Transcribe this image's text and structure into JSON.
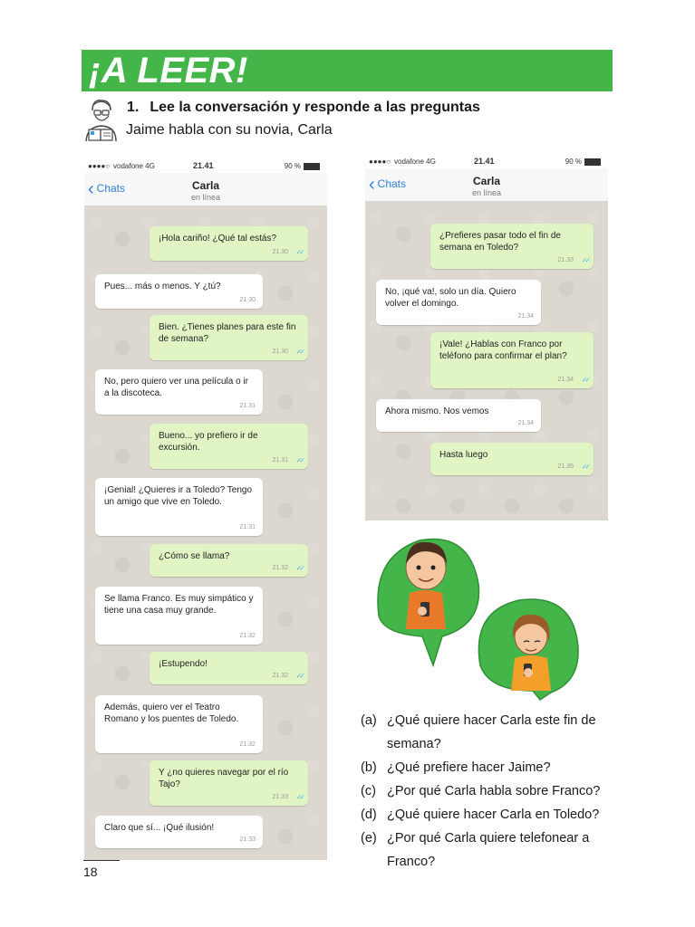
{
  "header": {
    "title": "¡A LEER!"
  },
  "exercise": {
    "number": "1.",
    "instruction": "Lee la conversación y responde a las preguntas",
    "subtitle": "Jaime habla con su novia, Carla"
  },
  "phone_status": {
    "dots": "●●●●○",
    "carrier": "vodafone  4G",
    "time": "21.41",
    "battery": "90 %"
  },
  "chat_header": {
    "back_label": "Chats",
    "contact": "Carla",
    "status": "en línea"
  },
  "chat1": [
    {
      "dir": "out",
      "text": "¡Hola cariño! ¿Qué tal estás?",
      "time": "21.30"
    },
    {
      "dir": "in",
      "text": "Pues... más o menos. Y ¿tú?",
      "time": "21.30"
    },
    {
      "dir": "out",
      "text": "Bien. ¿Tienes planes para este fin de semana?",
      "time": "21.30"
    },
    {
      "dir": "in",
      "text": "No, pero quiero ver una película o ir a la discoteca.",
      "time": "21.31"
    },
    {
      "dir": "out",
      "text": "Bueno... yo prefiero ir de excursión.",
      "time": "21.31"
    },
    {
      "dir": "in",
      "text": "¡Genial! ¿Quieres ir a Toledo? Tengo un amigo que vive en Toledo.",
      "time": "21.31"
    },
    {
      "dir": "out",
      "text": "¿Cómo se llama?",
      "time": "21.32"
    },
    {
      "dir": "in",
      "text": "Se llama Franco. Es muy simpático y tiene una casa muy grande.",
      "time": "21.32"
    },
    {
      "dir": "out",
      "text": "¡Estupendo!",
      "time": "21.32"
    },
    {
      "dir": "in",
      "text": "Además, quiero ver el Teatro Romano y los puentes de Toledo.",
      "time": "21.32"
    },
    {
      "dir": "out",
      "text": "Y ¿no quieres navegar por el río Tajo?",
      "time": "21.33"
    },
    {
      "dir": "in",
      "text": "Claro que sí... ¡Qué ilusión!",
      "time": "21.33"
    }
  ],
  "chat2": [
    {
      "dir": "out",
      "text": "¿Prefieres pasar todo el fin de semana en Toledo?",
      "time": "21.33"
    },
    {
      "dir": "in",
      "text": "No, ¡qué va!, solo un día. Quiero volver el domingo.",
      "time": "21.34"
    },
    {
      "dir": "out",
      "text": "¡Vale! ¿Hablas con Franco por teléfono para confirmar el plan?",
      "time": "21.34"
    },
    {
      "dir": "in",
      "text": "Ahora mismo. Nos vemos",
      "time": "21.34"
    },
    {
      "dir": "out",
      "text": "Hasta luego",
      "time": "21.35"
    }
  ],
  "questions": [
    {
      "label": "(a)",
      "text": "¿Qué quiere hacer Carla este fin de semana?"
    },
    {
      "label": "(b)",
      "text": "¿Qué prefiere hacer Jaime?"
    },
    {
      "label": "(c)",
      "text": "¿Por qué Carla habla sobre Franco?"
    },
    {
      "label": "(d)",
      "text": "¿Qué quiere hacer Carla en Toledo?"
    },
    {
      "label": "(e)",
      "text": "¿Por qué Carla quiere telefonear a Franco?"
    }
  ],
  "page_number": "18",
  "colors": {
    "banner": "#44b649",
    "outgoing": "#e1f5c4",
    "incoming": "#ffffff",
    "chat_bg": "#dcd7cf",
    "link": "#2f7fd6"
  }
}
